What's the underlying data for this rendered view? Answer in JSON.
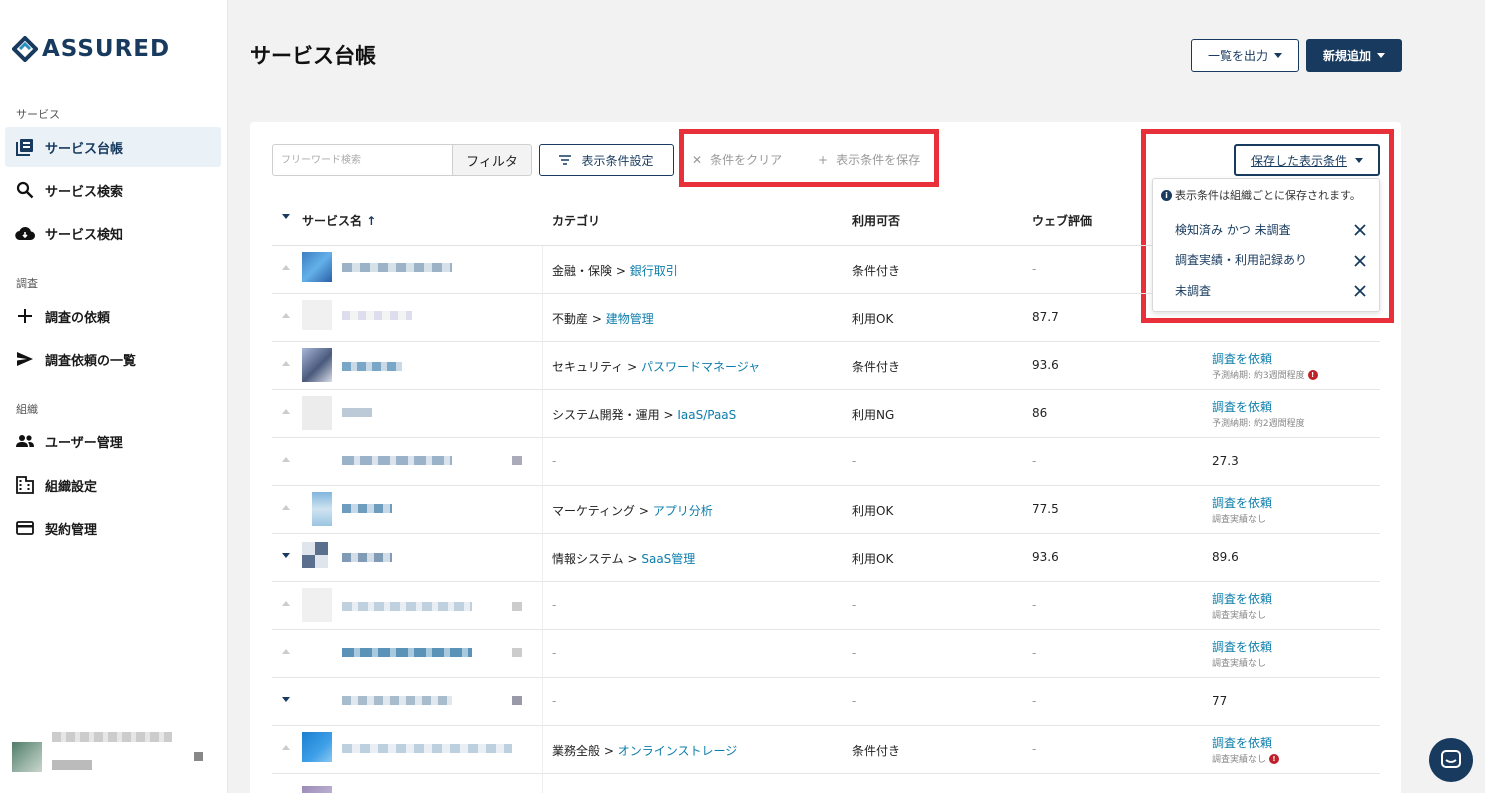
{
  "app": {
    "logo_text": "ASSURED",
    "colors": {
      "brand": "#173a5e",
      "link": "#0d7dab",
      "highlight": "#e8303a"
    }
  },
  "sidebar": {
    "sections": [
      {
        "label": "サービス"
      },
      {
        "label": "調査"
      },
      {
        "label": "組織"
      }
    ],
    "items": [
      {
        "label": "サービス台帳",
        "icon": "ledger-icon",
        "active": true
      },
      {
        "label": "サービス検索",
        "icon": "search-icon"
      },
      {
        "label": "サービス検知",
        "icon": "cloud-icon"
      },
      {
        "label": "調査の依頼",
        "icon": "plus-icon"
      },
      {
        "label": "調査依頼の一覧",
        "icon": "send-icon"
      },
      {
        "label": "ユーザー管理",
        "icon": "people-icon"
      },
      {
        "label": "組織設定",
        "icon": "building-icon"
      },
      {
        "label": "契約管理",
        "icon": "card-icon"
      }
    ]
  },
  "header": {
    "title": "サービス台帳",
    "export_label": "一覧を出力",
    "new_label": "新規追加"
  },
  "toolbar": {
    "search_placeholder": "フリーワード検索",
    "filter_label": "フィルタ",
    "display_label": "表示条件設定",
    "clear_label": "条件をクリア",
    "save_label": "表示条件を保存",
    "saved_label": "保存した表示条件"
  },
  "saved_dropdown": {
    "info": "表示条件は組織ごとに保存されます。",
    "items": [
      {
        "label": "検知済み かつ 未調査"
      },
      {
        "label": "調査実績・利用記録あり"
      },
      {
        "label": "未調査"
      }
    ]
  },
  "table": {
    "headers": {
      "name": "サービス名",
      "category": "カテゴリ",
      "usage": "利用可否",
      "web": "ウェブ評価"
    },
    "rows": [
      {
        "cat_parent": "金融・保険 >",
        "cat_child": "銀行取引",
        "usage": "条件付き",
        "web": "-",
        "req": "",
        "req_sub": "",
        "score": ""
      },
      {
        "cat_parent": "不動産 >",
        "cat_child": "建物管理",
        "usage": "利用OK",
        "web": "87.7",
        "req": "",
        "req_sub": "",
        "score": ""
      },
      {
        "cat_parent": "セキュリティ >",
        "cat_child": "パスワードマネージャ",
        "usage": "条件付き",
        "web": "93.6",
        "req": "調査を依頼",
        "req_sub": "予測納期: 約3週間程度",
        "score": ""
      },
      {
        "cat_parent": "システム開発・運用 >",
        "cat_child": "IaaS/PaaS",
        "usage": "利用NG",
        "web": "86",
        "req": "調査を依頼",
        "req_sub": "予測納期: 約2週間程度",
        "score": ""
      },
      {
        "cat_parent": "-",
        "cat_child": "",
        "usage": "-",
        "web": "-",
        "req": "",
        "req_sub": "",
        "score": "27.3"
      },
      {
        "cat_parent": "マーケティング >",
        "cat_child": "アプリ分析",
        "usage": "利用OK",
        "web": "77.5",
        "req": "調査を依頼",
        "req_sub": "調査実績なし",
        "score": ""
      },
      {
        "cat_parent": "情報システム >",
        "cat_child": "SaaS管理",
        "usage": "利用OK",
        "web": "93.6",
        "req": "",
        "req_sub": "",
        "score": "89.6"
      },
      {
        "cat_parent": "-",
        "cat_child": "",
        "usage": "-",
        "web": "-",
        "req": "調査を依頼",
        "req_sub": "調査実績なし",
        "score": ""
      },
      {
        "cat_parent": "-",
        "cat_child": "",
        "usage": "-",
        "web": "-",
        "req": "調査を依頼",
        "req_sub": "調査実績なし",
        "score": ""
      },
      {
        "cat_parent": "-",
        "cat_child": "",
        "usage": "-",
        "web": "-",
        "req": "",
        "req_sub": "",
        "score": "77"
      },
      {
        "cat_parent": "業務全般 >",
        "cat_child": "オンラインストレージ",
        "usage": "条件付き",
        "web": "-",
        "req": "調査を依頼",
        "req_sub": "調査実績なし",
        "score": ""
      }
    ]
  }
}
